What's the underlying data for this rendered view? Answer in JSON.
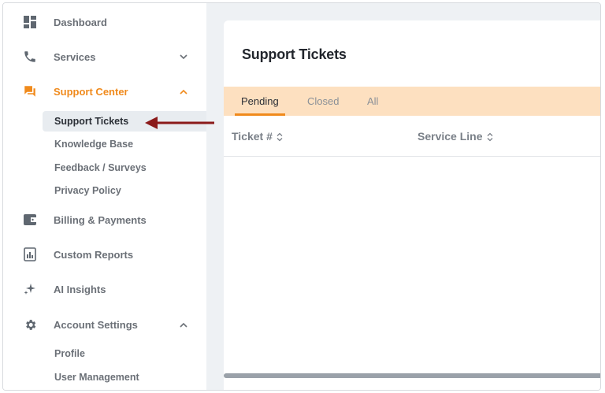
{
  "sidebar": {
    "items": [
      {
        "label": "Dashboard",
        "icon": "dashboard-icon"
      },
      {
        "label": "Services",
        "icon": "phone-icon",
        "chevron": "down"
      },
      {
        "label": "Support Center",
        "icon": "chat-icon",
        "chevron": "up",
        "active": true
      },
      {
        "label": "Billing & Payments",
        "icon": "wallet-icon"
      },
      {
        "label": "Custom Reports",
        "icon": "report-icon"
      },
      {
        "label": "AI Insights",
        "icon": "sparkle-icon"
      },
      {
        "label": "Account Settings",
        "icon": "gear-icon",
        "chevron": "up"
      }
    ],
    "support_sub": [
      {
        "label": "Support Tickets",
        "selected": true
      },
      {
        "label": "Knowledge Base"
      },
      {
        "label": "Feedback / Surveys"
      },
      {
        "label": "Privacy Policy"
      }
    ],
    "account_sub": [
      {
        "label": "Profile"
      },
      {
        "label": "User Management"
      }
    ]
  },
  "main": {
    "title": "Support Tickets",
    "tabs": [
      {
        "label": "Pending",
        "active": true
      },
      {
        "label": "Closed"
      },
      {
        "label": "All"
      }
    ],
    "columns": [
      {
        "label": "Ticket #"
      },
      {
        "label": "Service Line"
      }
    ]
  },
  "colors": {
    "accent": "#f08a1c",
    "tab_bar": "#fde0c0",
    "arrow": "#8b1a1a",
    "background": "#eef1f4"
  }
}
